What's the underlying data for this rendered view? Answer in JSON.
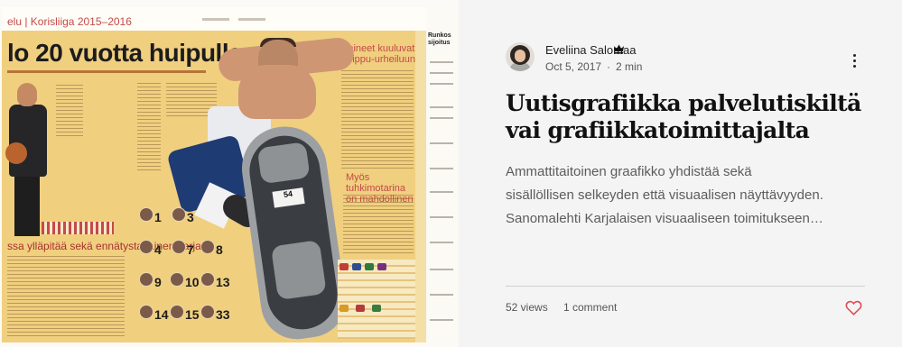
{
  "post": {
    "author": "Eveliina Salomaa",
    "author_badge_icon": "crown-icon",
    "date": "Oct 5, 2017",
    "separator": "·",
    "read_time": "2 min",
    "title": "Uutisgrafiikka palvelutiskiltä vai grafiikkatoimittajalta",
    "excerpt_lines": [
      "Ammattitaitoinen graafikko yhdistää sekä",
      "sisällöllisen selkeyden että visuaalisen näyttävyyden.",
      "Sanomalehti Karjalaisen visuaaliseen toimitukseen…"
    ],
    "views": "52 views",
    "comments": "1 comment",
    "more_icon": "more-vertical-icon",
    "like_icon": "heart-icon",
    "like_color": "#e0484c"
  },
  "cover": {
    "section_title": "elu | Korisliiga 2015–2016",
    "headline": "lo 20 vuotta huipulla",
    "right_heading": "Paineet kuuluvat huippu-urheiluun",
    "mid_heading": "Myös tuhkimotarina on mahdollinen",
    "bottom_caption": "ssa ylläpitää sekä ennätystasainen sarja",
    "side_title": "Runkos sijoitus",
    "shoe_tag": "54",
    "player_numbers": [
      "1",
      "3",
      "4",
      "7",
      "8",
      "9",
      "10",
      "13",
      "14",
      "15",
      "33"
    ]
  }
}
